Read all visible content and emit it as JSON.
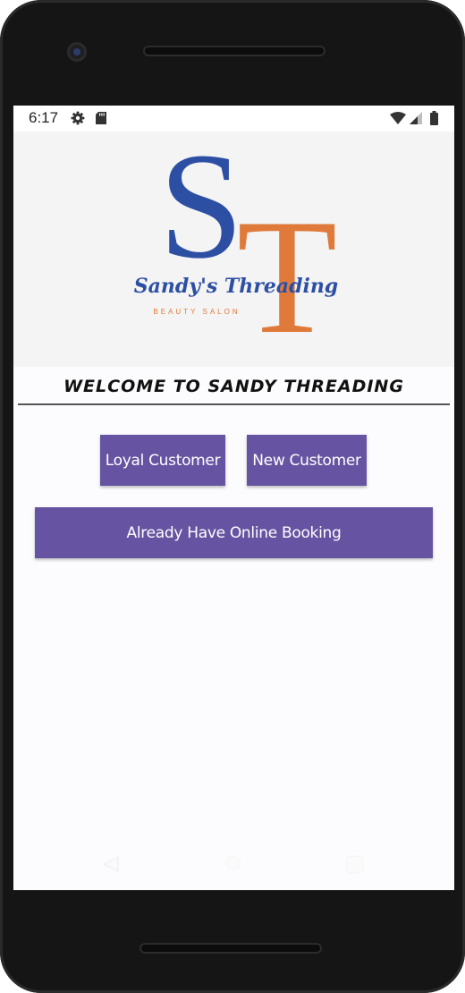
{
  "status_bar": {
    "time": "6:17",
    "icons": [
      "gear-icon",
      "sd-card-icon",
      "wifi-icon",
      "signal-icon",
      "battery-icon"
    ]
  },
  "logo": {
    "monogram_s": "S",
    "monogram_t": "T",
    "brand_name": "Sandy's Threading",
    "tagline": "BEAUTY SALON",
    "colors": {
      "blue": "#2d4fa3",
      "orange": "#e07a3a",
      "background": "#f4f4f4"
    }
  },
  "welcome_heading": "WELCOME TO SANDY THREADING",
  "buttons": {
    "loyal_customer": "Loyal Customer",
    "new_customer": "New Customer",
    "online_booking": "Already Have Online Booking"
  },
  "colors": {
    "button": "#6654a2",
    "button_text": "#ffffff",
    "screen_background": "#fcfbfe"
  },
  "navigation": [
    "back-icon",
    "home-icon",
    "recents-icon"
  ]
}
